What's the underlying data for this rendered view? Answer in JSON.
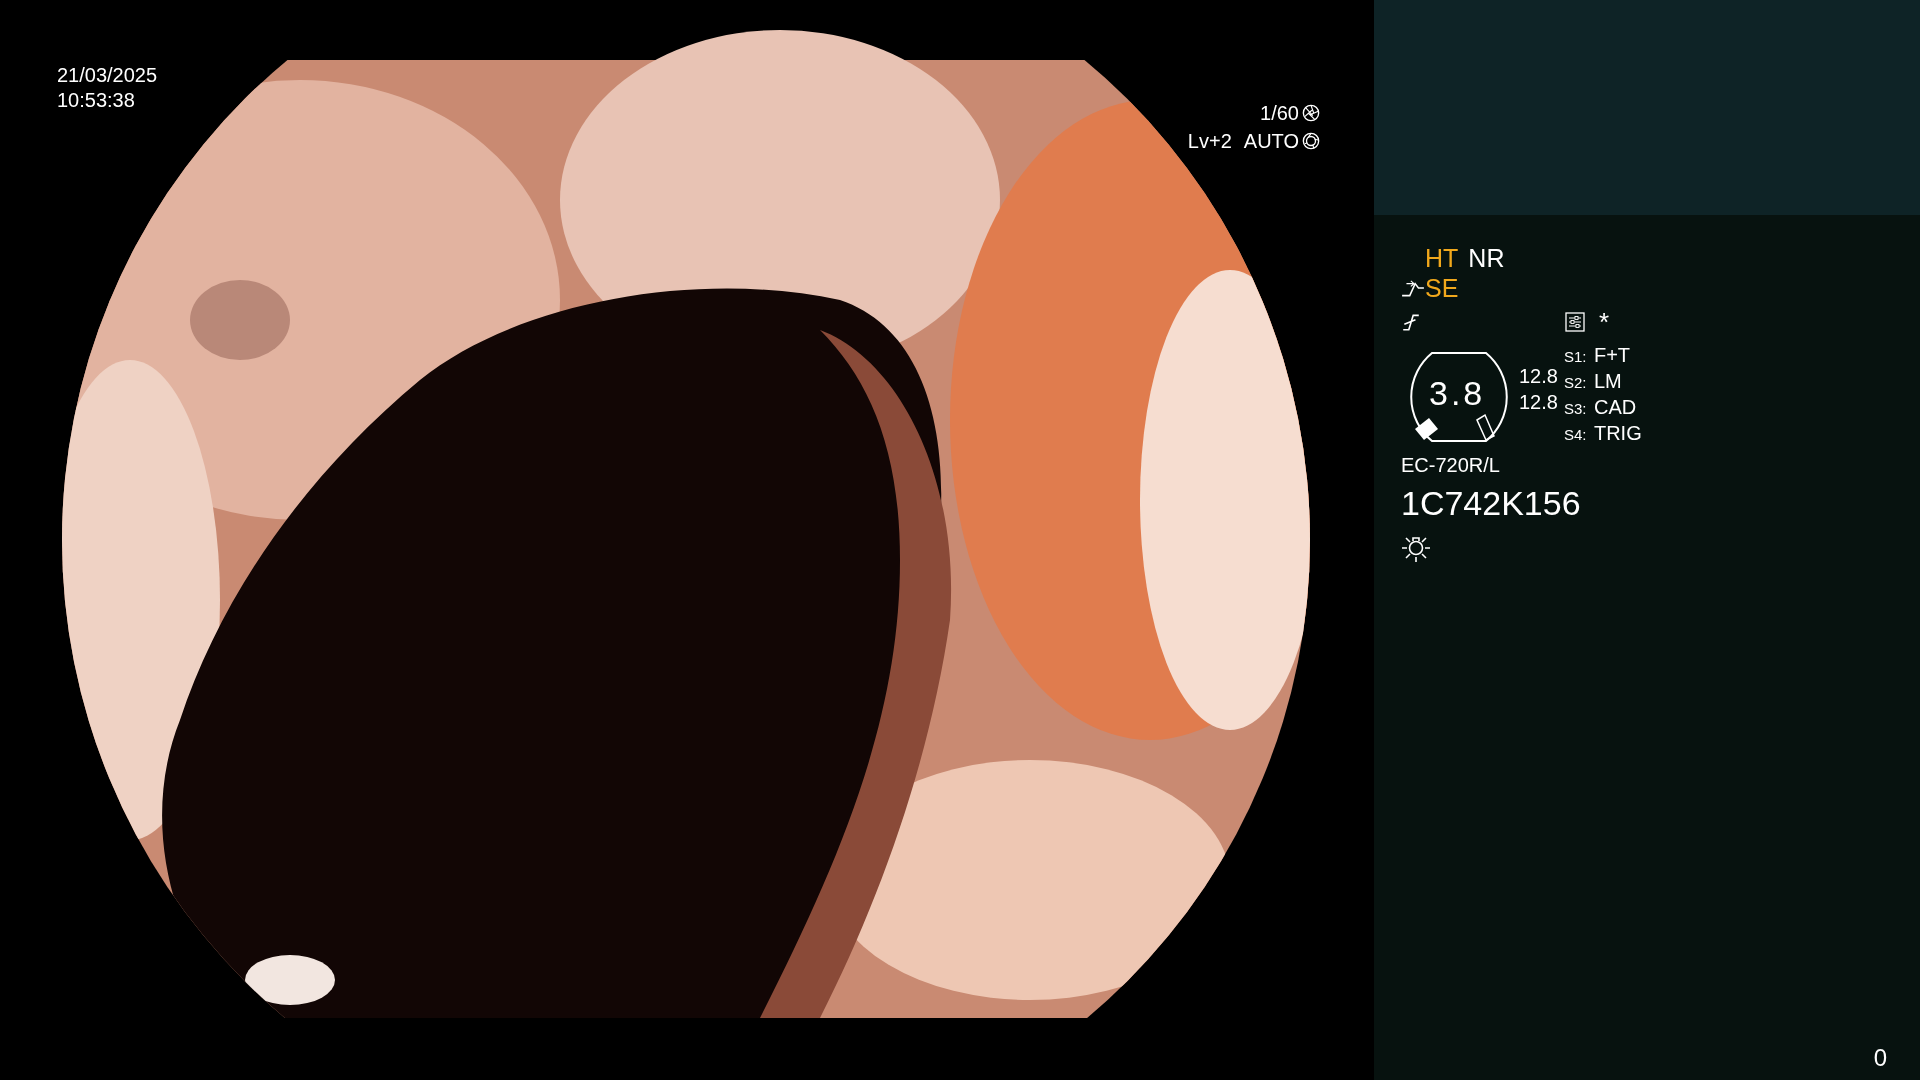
{
  "datetime": {
    "date": "21/03/2025",
    "time": "10:53:38"
  },
  "exposure": {
    "shutter": "1/60",
    "level": "Lv+2",
    "mode": "AUTO"
  },
  "panel": {
    "modes": [
      {
        "label": "HT",
        "active": true
      },
      {
        "label": "NR",
        "active": false
      }
    ],
    "enhance": {
      "label": "SE",
      "active": true
    },
    "asterisk": "*",
    "zoom": "3.8",
    "readings": [
      "12.8",
      "12.8"
    ],
    "switches": [
      {
        "key": "S1:",
        "value": "F+T"
      },
      {
        "key": "S2:",
        "value": "LM"
      },
      {
        "key": "S3:",
        "value": "CAD"
      },
      {
        "key": "S4:",
        "value": "TRIG"
      }
    ],
    "scope_model": "EC-720R/L",
    "serial": "1C742K156"
  },
  "counter": "0"
}
